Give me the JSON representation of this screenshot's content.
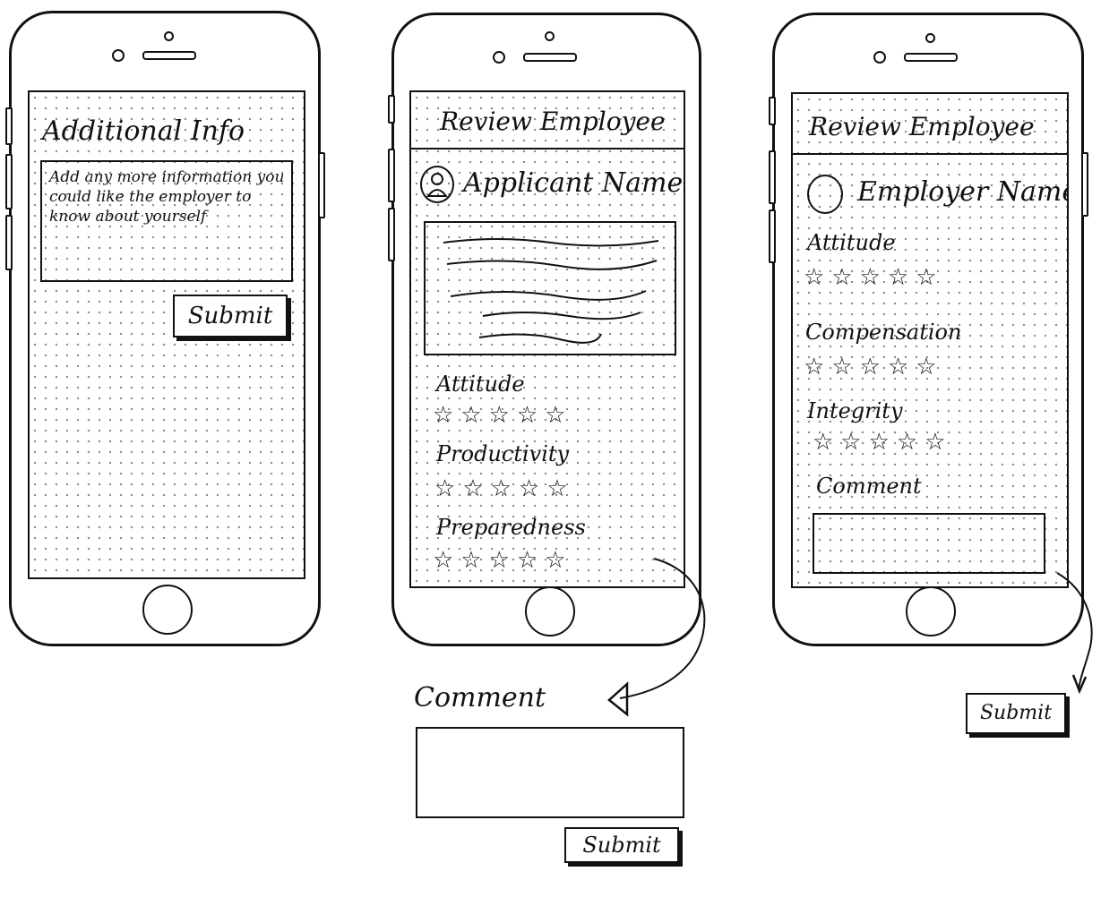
{
  "phone1": {
    "title": "Additional Info",
    "textarea_text": "Add any more information you could like the employer to know about yourself",
    "submit_label": "Submit"
  },
  "phone2": {
    "title": "Review Employee",
    "name": "Applicant Name",
    "ratings": [
      {
        "label": "Attitude",
        "stars": "☆☆☆☆☆"
      },
      {
        "label": "Productivity",
        "stars": "☆☆☆☆☆"
      },
      {
        "label": "Preparedness",
        "stars": "☆☆☆☆☆"
      }
    ],
    "comment_label": "Comment",
    "submit_label": "Submit"
  },
  "phone3": {
    "title": "Review Employee",
    "name": "Employer Name",
    "ratings": [
      {
        "label": "Attitude",
        "stars": "☆☆☆☆☆"
      },
      {
        "label": "Compensation",
        "stars": "☆☆☆☆☆"
      },
      {
        "label": "Integrity",
        "stars": "☆☆☆☆☆"
      }
    ],
    "comment_label": "Comment",
    "submit_label": "Submit"
  },
  "icons": {
    "avatar": "person-icon",
    "star": "star-icon",
    "arrow": "arrow-icon"
  },
  "colors": {
    "ink": "#111111",
    "paper": "#ffffff",
    "dots": "#8a8a8a"
  }
}
